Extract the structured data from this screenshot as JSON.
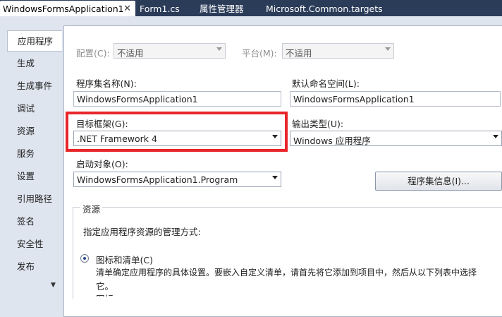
{
  "tabs": {
    "active_label": "WindowsFormsApplication1",
    "close_glyph": "✕",
    "others": [
      "Form1.cs",
      "属性管理器",
      "Microsoft.Common.targets"
    ]
  },
  "nav": {
    "items": [
      "应用程序",
      "生成",
      "生成事件",
      "调试",
      "资源",
      "服务",
      "设置",
      "引用路径",
      "签名",
      "安全性",
      "发布"
    ],
    "selected_index": 0,
    "scroll_glyph": "▼"
  },
  "config": {
    "configuration_label": "配置(C):",
    "configuration_value": "不适用",
    "platform_label": "平台(M):",
    "platform_value": "不适用"
  },
  "form": {
    "assembly_name_label": "程序集名称(N):",
    "assembly_name_value": "WindowsFormsApplication1",
    "default_namespace_label": "默认命名空间(L):",
    "default_namespace_value": "WindowsFormsApplication1",
    "target_framework_label": "目标框架(G):",
    "target_framework_value": ".NET Framework 4",
    "output_type_label": "输出类型(U):",
    "output_type_value": "Windows 应用程序",
    "startup_object_label": "启动对象(O):",
    "startup_object_value": "WindowsFormsApplication1.Program",
    "assembly_info_button": "程序集信息(I)..."
  },
  "resources": {
    "group_title": "资源",
    "description": "指定应用程序资源的管理方式:",
    "option_label": "图标和清单(C)",
    "option_desc_line1": "清单确定应用程序的具体设置。要嵌入自定义清单，请首先将它添加到项目中，然后从以下列表中选择",
    "option_desc_line2": "它。",
    "cut_label": "图标"
  },
  "colors": {
    "tab_strip": "#2b3c59",
    "panel_bg": "#dfe5ef",
    "highlight_border": "#e8262b"
  }
}
